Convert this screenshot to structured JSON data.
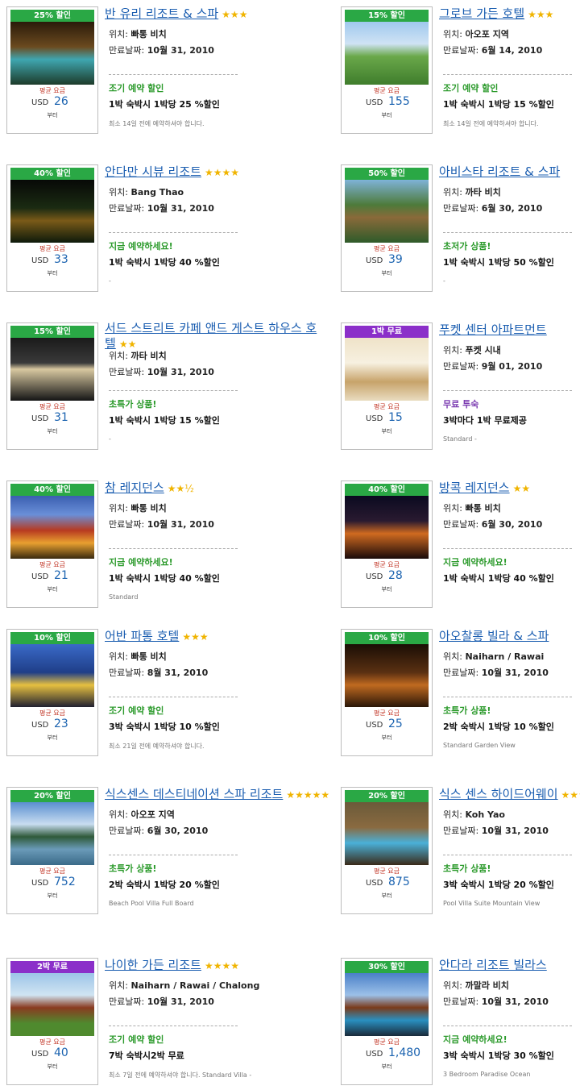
{
  "labels": {
    "location": "위치:",
    "expiry": "만료날짜:",
    "price_label": "평균 요금",
    "currency": "USD",
    "from": "부터"
  },
  "colors": {
    "green": "#2aa845",
    "purple": "#8b2fc9",
    "link": "#1a5db0",
    "promo_green": "#2b9a2b",
    "promo_purple": "#7a3ab0"
  },
  "hotels": [
    {
      "badge": "25% 할인",
      "badge_color": "green",
      "name": "반 유리 리조트 & 스파",
      "stars": "★★★",
      "location": "빠통 비치",
      "expiry": "10월 31, 2010",
      "promo": "조기 예약 할인",
      "promo_color": "promo_green",
      "deal": "1박 숙박시 1박당 25 %할인",
      "note": "최소 14일 전에 예약하셔야 합니다.",
      "price": "26",
      "photo": "pool-night"
    },
    {
      "badge": "15% 할인",
      "badge_color": "green",
      "name": "그로브 가든 호텔",
      "stars": "★★★",
      "location": "아오포 지역",
      "expiry": "6월 14, 2010",
      "promo": "조기 예약 할인",
      "promo_color": "promo_green",
      "deal": "1박 숙박시 1박당 15 %할인",
      "note": "최소 14일 전에 예약하셔야 합니다.",
      "price": "155",
      "photo": "golf"
    },
    {
      "badge": "40% 할인",
      "badge_color": "green",
      "name": "안다만 시뷰 리조트",
      "stars": "★★★★",
      "location": "Bang Thao",
      "expiry": "10월 31, 2010",
      "promo": "지금 예약하세요!",
      "promo_color": "promo_green",
      "deal": "1박 숙박시 1박당 40 %할인",
      "note": "-",
      "price": "33",
      "photo": "night-garden"
    },
    {
      "badge": "50% 할인",
      "badge_color": "green",
      "name": "아비스타 리조트 & 스파",
      "stars": "",
      "location": "까타 비치",
      "expiry": "6월 30, 2010",
      "promo": "초저가 상품!",
      "promo_color": "promo_green",
      "deal": "1박 숙박시 1박당 50 %할인",
      "note": "-",
      "price": "39",
      "photo": "tropical"
    },
    {
      "badge": "15% 할인",
      "badge_color": "green",
      "name": "서드 스트리트 카페 앤드 게스트 하우스 호텔",
      "stars": "★★",
      "location": "까타 비치",
      "expiry": "10월 31, 2010",
      "promo": "초특가 상품!",
      "promo_color": "promo_green",
      "deal": "1박 숙박시 1박당 15 %할인",
      "note": "-",
      "price": "31",
      "photo": "dark-building"
    },
    {
      "badge": "1박 무료",
      "badge_color": "purple",
      "name": "푸켓 센터 아파트먼트",
      "stars": "",
      "location": "푸켓 시내",
      "expiry": "9월 01, 2010",
      "promo": "무료 투숙",
      "promo_color": "promo_purple",
      "deal": "3박마다 1박 무료제공",
      "note": "Standard -",
      "price": "15",
      "photo": "room"
    },
    {
      "badge": "40% 할인",
      "badge_color": "green",
      "name": "참 레지던스",
      "stars": "★★½",
      "location": "빠통 비치",
      "expiry": "10월 31, 2010",
      "promo": "지금 예약하세요!",
      "promo_color": "promo_green",
      "deal": "1박 숙박시 1박당 40 %할인",
      "note": "Standard",
      "price": "21",
      "photo": "thai-roof"
    },
    {
      "badge": "40% 할인",
      "badge_color": "green",
      "name": "방콕 레지던스",
      "stars": "★★",
      "location": "빠통 비치",
      "expiry": "6월 30, 2010",
      "promo": "지금 예약하세요!",
      "promo_color": "promo_green",
      "deal": "1박 숙박시 1박당 40 %할인",
      "note": "",
      "price": "28",
      "photo": "street-night"
    },
    {
      "badge": "10% 할인",
      "badge_color": "green",
      "name": "어반 파통 호텔",
      "stars": "★★★",
      "location": "빠통 비치",
      "expiry": "8월 31, 2010",
      "promo": "조기 예약 할인",
      "promo_color": "promo_green",
      "deal": "3박 숙박시 1박당 10 %할인",
      "note": "최소 21일 전에 예약하셔야 합니다.",
      "price": "23",
      "photo": "tower-night"
    },
    {
      "badge": "10% 할인",
      "badge_color": "green",
      "name": "아오찰롱 빌라 & 스파",
      "stars": "",
      "location": "Naiharn / Rawai",
      "expiry": "10월 31, 2010",
      "promo": "초특가 상품!",
      "promo_color": "promo_green",
      "deal": "2박 숙박시 1박당 10 %할인",
      "note": "Standard Garden View",
      "price": "25",
      "photo": "villa-night"
    },
    {
      "badge": "20% 할인",
      "badge_color": "green",
      "name": "식스센스 데스티네이션 스파 리조트",
      "stars": "★★★★★",
      "location": "아오포 지역",
      "expiry": "6월 30, 2010",
      "promo": "초특가 상품!",
      "promo_color": "promo_green",
      "deal": "2박 숙박시 1박당 20 %할인",
      "note": "Beach Pool Villa Full Board",
      "price": "752",
      "photo": "lagoon"
    },
    {
      "badge": "20% 할인",
      "badge_color": "green",
      "name": "식스 센스 하이드어웨이",
      "stars": "★★★★★",
      "location": "Koh Yao",
      "expiry": "10월 31, 2010",
      "promo": "초특가 상품!",
      "promo_color": "promo_green",
      "deal": "3박 숙박시 1박당 20 %할인",
      "note": "Pool Villa Suite Mountain View",
      "price": "875",
      "photo": "wood-villa"
    },
    {
      "badge": "2박 무료",
      "badge_color": "purple",
      "name": "나이한 가든 리조트",
      "stars": "★★★★",
      "location": "Naiharn / Rawai / Chalong",
      "expiry": "10월 31, 2010",
      "promo": "조기 예약 할인",
      "promo_color": "promo_green",
      "deal": "7박 숙박시2박 무료",
      "note": "최소 7일 전에 예약하셔야 합니다. Standard Villa -",
      "price": "40",
      "photo": "garden-house"
    },
    {
      "badge": "30% 할인",
      "badge_color": "green",
      "name": "안다라 리조트 빌라스",
      "stars": "",
      "location": "까말라 비치",
      "expiry": "10월 31, 2010",
      "promo": "지금 예약하세요!",
      "promo_color": "promo_green",
      "deal": "3박 숙박시 1박당 30 %할인",
      "note": "3 Bedroom Paradise Ocean",
      "price": "1,480",
      "photo": "sea-pool"
    }
  ]
}
